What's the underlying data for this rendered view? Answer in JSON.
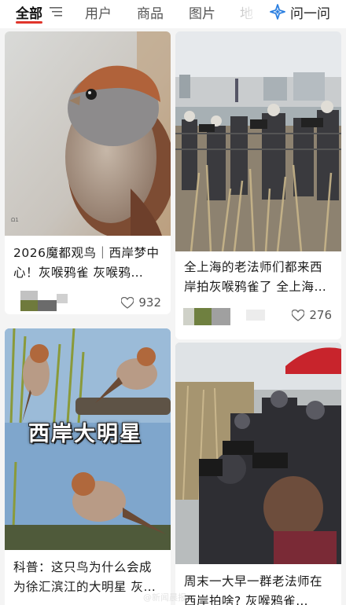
{
  "tabs": [
    {
      "label": "全部",
      "active": true
    },
    {
      "label": "用户",
      "active": false
    },
    {
      "label": "商品",
      "active": false
    },
    {
      "label": "图片",
      "active": false
    },
    {
      "label": "地",
      "active": false
    }
  ],
  "ask": {
    "label": "问一问",
    "icon": "sparkle-icon"
  },
  "cards": [
    {
      "title": "2026魔都观鸟｜西岸梦中心！灰喉鸦雀 灰喉鸦…",
      "likes": "932",
      "photo_credit": "Ω1"
    },
    {
      "title": "全上海的老法师们都来西岸拍灰喉鸦雀了 全上海…",
      "likes": "276"
    },
    {
      "title": "科普：这只鸟为什么会成为徐汇滨江的大明星 灰…",
      "overlay": "西岸大明星"
    },
    {
      "title": "周末一大早一群老法师在西岸拍啥? 灰喉鸦雀…"
    }
  ],
  "watermark": "@新闻晨报",
  "colors": {
    "accent": "#e0352b",
    "ask_icon": "#2b7fe0"
  }
}
